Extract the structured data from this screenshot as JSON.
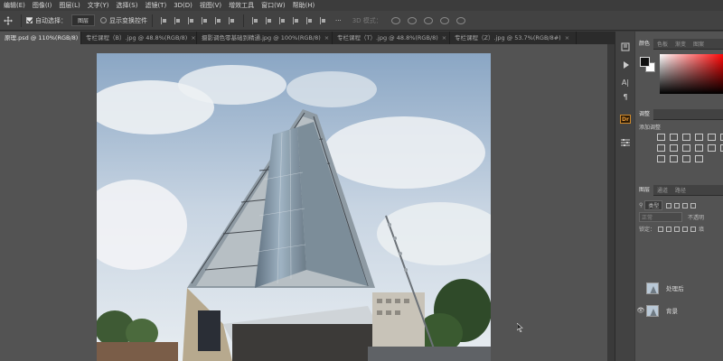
{
  "menubar": {
    "items": [
      "编辑(E)",
      "图像(I)",
      "图层(L)",
      "文字(Y)",
      "选择(S)",
      "滤镜(T)",
      "3D(D)",
      "视图(V)",
      "增效工具",
      "窗口(W)",
      "帮助(H)"
    ]
  },
  "options": {
    "auto_select_label": "自动选择：",
    "auto_select_value": "图层",
    "show_transform_label": "显示变换控件",
    "mode_3d_label": "3D 模式："
  },
  "tabs": [
    {
      "label": "原理.psd @ 110%(RGB/8)",
      "close": "×"
    },
    {
      "label": "专栏课程（B）.jpg @ 48.8%(RGB/8)",
      "close": "×"
    },
    {
      "label": "摄影调色零基础到精通.jpg @ 100%(RGB/8)",
      "close": "×"
    },
    {
      "label": "专栏课程（T）.jpg @ 48.8%(RGB/8)",
      "close": "×"
    },
    {
      "label": "专栏课程（Z）.jpg @ 53.7%(RGB/8#)",
      "close": "×"
    }
  ],
  "color_panel": {
    "tabs": [
      "颜色",
      "色板",
      "渐变",
      "图案"
    ],
    "foreground": "#111111",
    "background": "#ffffff"
  },
  "adjustments_panel": {
    "tab": "调整",
    "title": "添加调整"
  },
  "layers_panel": {
    "tabs": [
      "图层",
      "通道",
      "路径"
    ],
    "filter_kind": "类型",
    "blend_mode": "正常",
    "opacity_label": "不透明",
    "lock_label": "锁定：",
    "fill_label": "填",
    "layers": [
      {
        "name": "处理后",
        "visible": false
      },
      {
        "name": "背景",
        "visible": true
      }
    ]
  },
  "right_strip": {
    "dr_label": "Dr",
    "text_tool": "A|",
    "para_tool": "¶"
  }
}
